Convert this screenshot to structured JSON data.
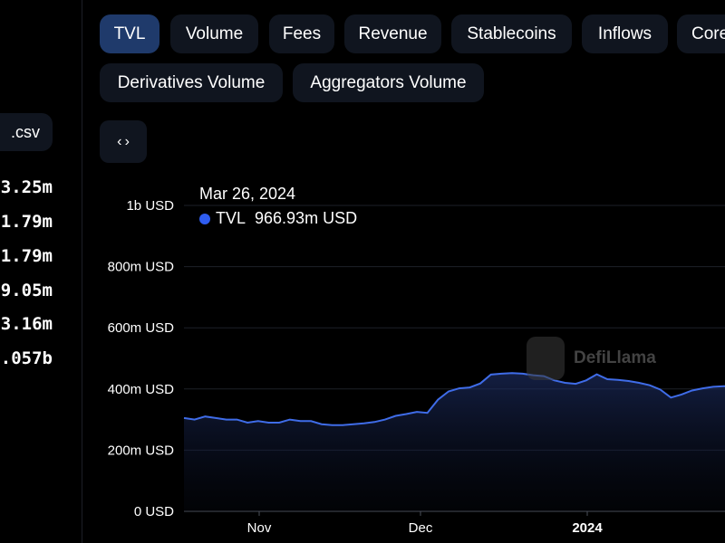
{
  "tabs": [
    {
      "label": "TVL",
      "active": true
    },
    {
      "label": "Volume",
      "active": false
    },
    {
      "label": "Fees",
      "active": false
    },
    {
      "label": "Revenue",
      "active": false
    },
    {
      "label": "Stablecoins",
      "active": false
    },
    {
      "label": "Inflows",
      "active": false
    },
    {
      "label": "Core",
      "active": false
    },
    {
      "label": "Derivatives Volume",
      "active": false
    },
    {
      "label": "Aggregators Volume",
      "active": false
    }
  ],
  "left_panel": {
    "csv_label": ".csv",
    "stats": [
      "3.25m",
      "1.79m",
      "1.79m",
      "9.05m",
      "3.16m",
      ".057b"
    ]
  },
  "embed_icon": "code-brackets-icon",
  "tooltip": {
    "date": "Mar 26, 2024",
    "series_label": "TVL",
    "value": "966.93m USD"
  },
  "watermark": {
    "text": "DefiLlama"
  },
  "colors": {
    "line": "#3f6ce8",
    "active_tab": "#1f3a6b",
    "button_bg": "#10151f"
  },
  "chart_data": {
    "type": "area",
    "title": "",
    "xlabel": "",
    "ylabel": "",
    "x_tick_labels": [
      "Nov",
      "Dec",
      "2024"
    ],
    "y_tick_labels": [
      "0 USD",
      "200m USD",
      "400m USD",
      "600m USD",
      "800m USD",
      "1b USD"
    ],
    "ylim": [
      0,
      1000
    ],
    "y_unit": "millions USD",
    "grid": true,
    "series": [
      {
        "name": "TVL",
        "x": [
          "2023-10-14",
          "2023-10-16",
          "2023-10-18",
          "2023-10-20",
          "2023-10-22",
          "2023-10-24",
          "2023-10-26",
          "2023-10-28",
          "2023-10-30",
          "2023-11-01",
          "2023-11-03",
          "2023-11-05",
          "2023-11-07",
          "2023-11-09",
          "2023-11-11",
          "2023-11-13",
          "2023-11-15",
          "2023-11-17",
          "2023-11-19",
          "2023-11-21",
          "2023-11-23",
          "2023-11-25",
          "2023-11-27",
          "2023-11-29",
          "2023-12-01",
          "2023-12-03",
          "2023-12-05",
          "2023-12-07",
          "2023-12-09",
          "2023-12-11",
          "2023-12-13",
          "2023-12-15",
          "2023-12-17",
          "2023-12-19",
          "2023-12-21",
          "2023-12-23",
          "2023-12-25",
          "2023-12-27",
          "2023-12-29",
          "2023-12-31",
          "2024-01-02",
          "2024-01-04",
          "2024-01-06",
          "2024-01-08",
          "2024-01-10",
          "2024-01-12",
          "2024-01-14",
          "2024-01-16",
          "2024-01-18",
          "2024-01-20",
          "2024-01-22",
          "2024-01-24",
          "2024-01-26"
        ],
        "values": [
          305,
          300,
          310,
          305,
          300,
          300,
          290,
          295,
          290,
          290,
          300,
          295,
          295,
          285,
          282,
          282,
          285,
          288,
          292,
          300,
          312,
          318,
          325,
          322,
          365,
          392,
          402,
          405,
          418,
          447,
          450,
          452,
          450,
          445,
          442,
          428,
          420,
          417,
          428,
          448,
          432,
          430,
          426,
          420,
          412,
          398,
          372,
          382,
          395,
          402,
          407,
          409,
          410
        ]
      }
    ]
  }
}
